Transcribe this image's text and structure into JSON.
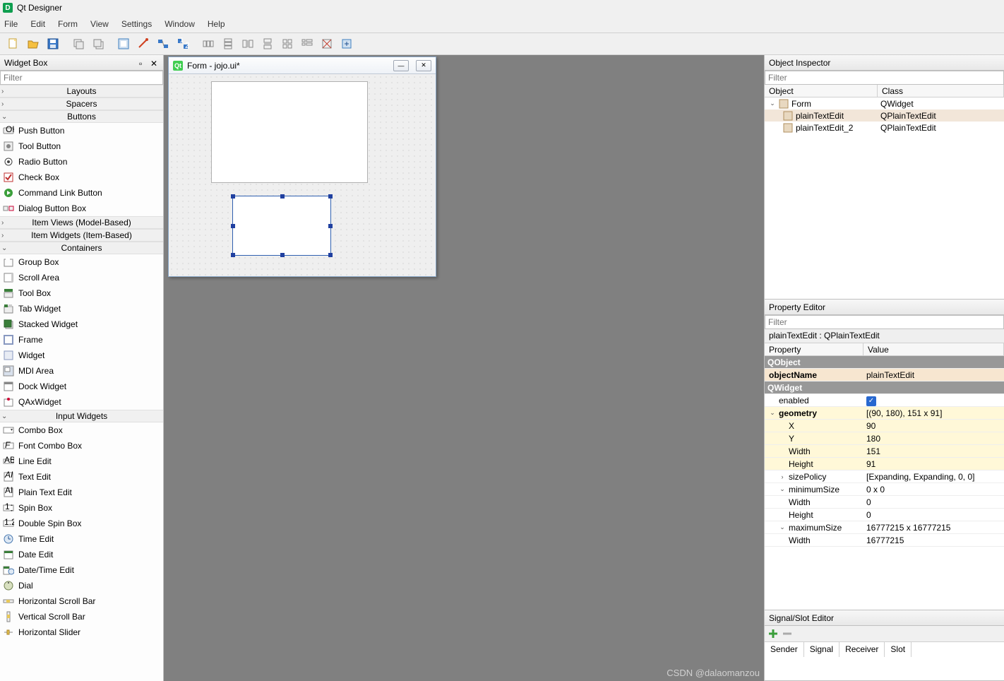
{
  "app": {
    "title": "Qt Designer"
  },
  "menu": [
    "File",
    "Edit",
    "Form",
    "View",
    "Settings",
    "Window",
    "Help"
  ],
  "widgetbox": {
    "title": "Widget Box",
    "filter_placeholder": "Filter",
    "cats": {
      "layouts": "Layouts",
      "spacers": "Spacers",
      "buttons": "Buttons",
      "itemviews": "Item Views (Model-Based)",
      "itemwidgets": "Item Widgets (Item-Based)",
      "containers": "Containers",
      "inputwidgets": "Input Widgets"
    },
    "buttons_items": [
      "Push Button",
      "Tool Button",
      "Radio Button",
      "Check Box",
      "Command Link Button",
      "Dialog Button Box"
    ],
    "containers_items": [
      "Group Box",
      "Scroll Area",
      "Tool Box",
      "Tab Widget",
      "Stacked Widget",
      "Frame",
      "Widget",
      "MDI Area",
      "Dock Widget",
      "QAxWidget"
    ],
    "input_items": [
      "Combo Box",
      "Font Combo Box",
      "Line Edit",
      "Text Edit",
      "Plain Text Edit",
      "Spin Box",
      "Double Spin Box",
      "Time Edit",
      "Date Edit",
      "Date/Time Edit",
      "Dial",
      "Horizontal Scroll Bar",
      "Vertical Scroll Bar",
      "Horizontal Slider"
    ]
  },
  "form": {
    "title": "Form - jojo.ui*"
  },
  "objectInspector": {
    "title": "Object Inspector",
    "filter_placeholder": "Filter",
    "cols": {
      "object": "Object",
      "class": "Class"
    },
    "rows": [
      {
        "obj": "Form",
        "cls": "QWidget",
        "indent": 0,
        "exp": "v"
      },
      {
        "obj": "plainTextEdit",
        "cls": "QPlainTextEdit",
        "indent": 1,
        "sel": true
      },
      {
        "obj": "plainTextEdit_2",
        "cls": "QPlainTextEdit",
        "indent": 1
      }
    ]
  },
  "propertyEditor": {
    "title": "Property Editor",
    "filter_placeholder": "Filter",
    "object_line": "plainTextEdit : QPlainTextEdit",
    "cols": {
      "prop": "Property",
      "val": "Value"
    },
    "rows": [
      {
        "type": "group",
        "prop": "QObject"
      },
      {
        "prop": "objectName",
        "val": "plainTextEdit",
        "style": "on-sel",
        "bold": true
      },
      {
        "type": "group",
        "prop": "QWidget"
      },
      {
        "prop": "enabled",
        "val": "",
        "check": true,
        "indent": 1
      },
      {
        "prop": "geometry",
        "val": "[(90, 180), 151 x 91]",
        "style": "yellow",
        "exp": "v",
        "bold": true
      },
      {
        "prop": "X",
        "val": "90",
        "style": "yellow",
        "indent": 2
      },
      {
        "prop": "Y",
        "val": "180",
        "style": "yellow",
        "indent": 2
      },
      {
        "prop": "Width",
        "val": "151",
        "style": "yellow",
        "indent": 2
      },
      {
        "prop": "Height",
        "val": "91",
        "style": "yellow",
        "indent": 2
      },
      {
        "prop": "sizePolicy",
        "val": "[Expanding, Expanding, 0, 0]",
        "exp": ">",
        "indent": 1
      },
      {
        "prop": "minimumSize",
        "val": "0 x 0",
        "exp": "v",
        "indent": 1
      },
      {
        "prop": "Width",
        "val": "0",
        "indent": 2
      },
      {
        "prop": "Height",
        "val": "0",
        "indent": 2
      },
      {
        "prop": "maximumSize",
        "val": "16777215 x 16777215",
        "exp": "v",
        "indent": 1
      },
      {
        "prop": "Width",
        "val": "16777215",
        "indent": 2
      }
    ]
  },
  "signalSlot": {
    "title": "Signal/Slot Editor",
    "cols": [
      "Sender",
      "Signal",
      "Receiver",
      "Slot"
    ]
  },
  "watermark": "CSDN @dalaomanzou"
}
